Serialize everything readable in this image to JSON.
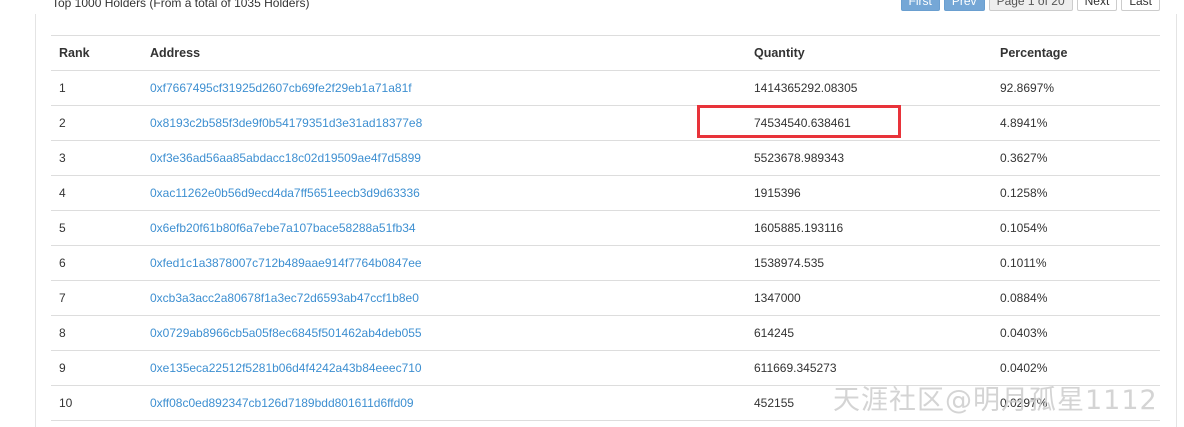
{
  "summary": "Top 1000 Holders (From a total of 1035 Holders)",
  "pager": {
    "first": "First",
    "prev": "Prev",
    "page": "Page 1 of 20",
    "next": "Next",
    "last": "Last"
  },
  "table": {
    "headers": {
      "rank": "Rank",
      "address": "Address",
      "quantity": "Quantity",
      "percentage": "Percentage"
    },
    "rows": [
      {
        "rank": "1",
        "address": "0xf7667495cf31925d2607cb69fe2f29eb1a71a81f",
        "quantity": "1414365292.08305",
        "percentage": "92.8697%"
      },
      {
        "rank": "2",
        "address": "0x8193c2b585f3de9f0b54179351d3e31ad18377e8",
        "quantity": "74534540.638461",
        "percentage": "4.8941%"
      },
      {
        "rank": "3",
        "address": "0xf3e36ad56aa85abdacc18c02d19509ae4f7d5899",
        "quantity": "5523678.989343",
        "percentage": "0.3627%"
      },
      {
        "rank": "4",
        "address": "0xac11262e0b56d9ecd4da7ff5651eecb3d9d63336",
        "quantity": "1915396",
        "percentage": "0.1258%"
      },
      {
        "rank": "5",
        "address": "0x6efb20f61b80f6a7ebe7a107bace58288a51fb34",
        "quantity": "1605885.193116",
        "percentage": "0.1054%"
      },
      {
        "rank": "6",
        "address": "0xfed1c1a3878007c712b489aae914f7764b0847ee",
        "quantity": "1538974.535",
        "percentage": "0.1011%"
      },
      {
        "rank": "7",
        "address": "0xcb3a3acc2a80678f1a3ec72d6593ab47ccf1b8e0",
        "quantity": "1347000",
        "percentage": "0.0884%"
      },
      {
        "rank": "8",
        "address": "0x0729ab8966cb5a05f8ec6845f501462ab4deb055",
        "quantity": "614245",
        "percentage": "0.0403%"
      },
      {
        "rank": "9",
        "address": "0xe135eca22512f5281b06d4f4242a43b84eeec710",
        "quantity": "611669.345273",
        "percentage": "0.0402%"
      },
      {
        "rank": "10",
        "address": "0xff08c0ed892347cb126d7189bdd801611d6ffd09",
        "quantity": "452155",
        "percentage": "0.0297%"
      }
    ]
  },
  "highlight_color": "#e8333a",
  "link_color": "#3d8fd1",
  "watermark": "天涯社区@明月孤星1112"
}
